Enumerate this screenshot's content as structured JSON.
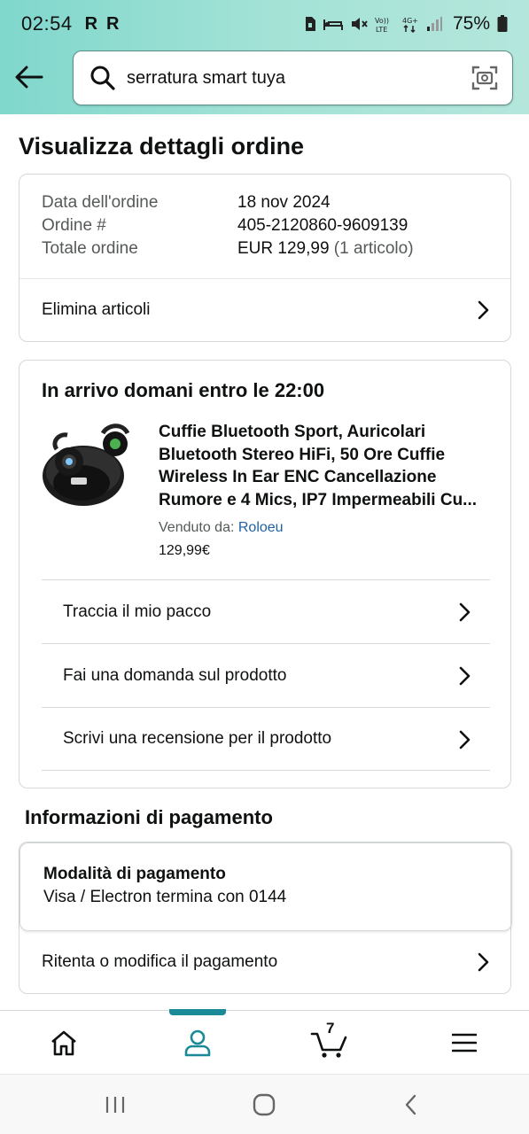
{
  "status_bar": {
    "time": "02:54",
    "r_badges": [
      "R",
      "R"
    ],
    "battery": "75%"
  },
  "search": {
    "query": "serratura smart tuya"
  },
  "page": {
    "title": "Visualizza dettagli ordine"
  },
  "order": {
    "fields": [
      {
        "label": "Data dell'ordine",
        "value": "18 nov 2024"
      },
      {
        "label": "Ordine #",
        "value": "405-2120860-9609139"
      },
      {
        "label": "Totale ordine",
        "value": "EUR 129,99",
        "extra": "(1 articolo)"
      }
    ],
    "delete_items": "Elimina articoli"
  },
  "shipment": {
    "title": "In arrivo domani entro le 22:00",
    "product_name": "Cuffie Bluetooth Sport, Auricolari Bluetooth Stereo HiFi, 50 Ore Cuffie Wireless In Ear ENC Cancellazione Rumore e 4 Mics, IP7 Impermeabili Cu...",
    "seller_label": "Venduto da:",
    "seller_name": "Roloeu",
    "price": "129,99€",
    "actions": [
      "Traccia il mio pacco",
      "Fai una domanda sul prodotto",
      "Scrivi una recensione per il prodotto"
    ]
  },
  "payment": {
    "section_title": "Informazioni di pagamento",
    "mode_label": "Modalità di pagamento",
    "card": "Visa / Electron  termina con 0144",
    "retry": "Ritenta o modifica il pagamento"
  },
  "bottom_nav": {
    "cart_count": "7",
    "active": "profile"
  },
  "colors": {
    "header_gradient_start": "#80d7cc",
    "header_gradient_end": "#b4e6dc",
    "link": "#2162a1",
    "active_tab": "#1a8a97"
  }
}
